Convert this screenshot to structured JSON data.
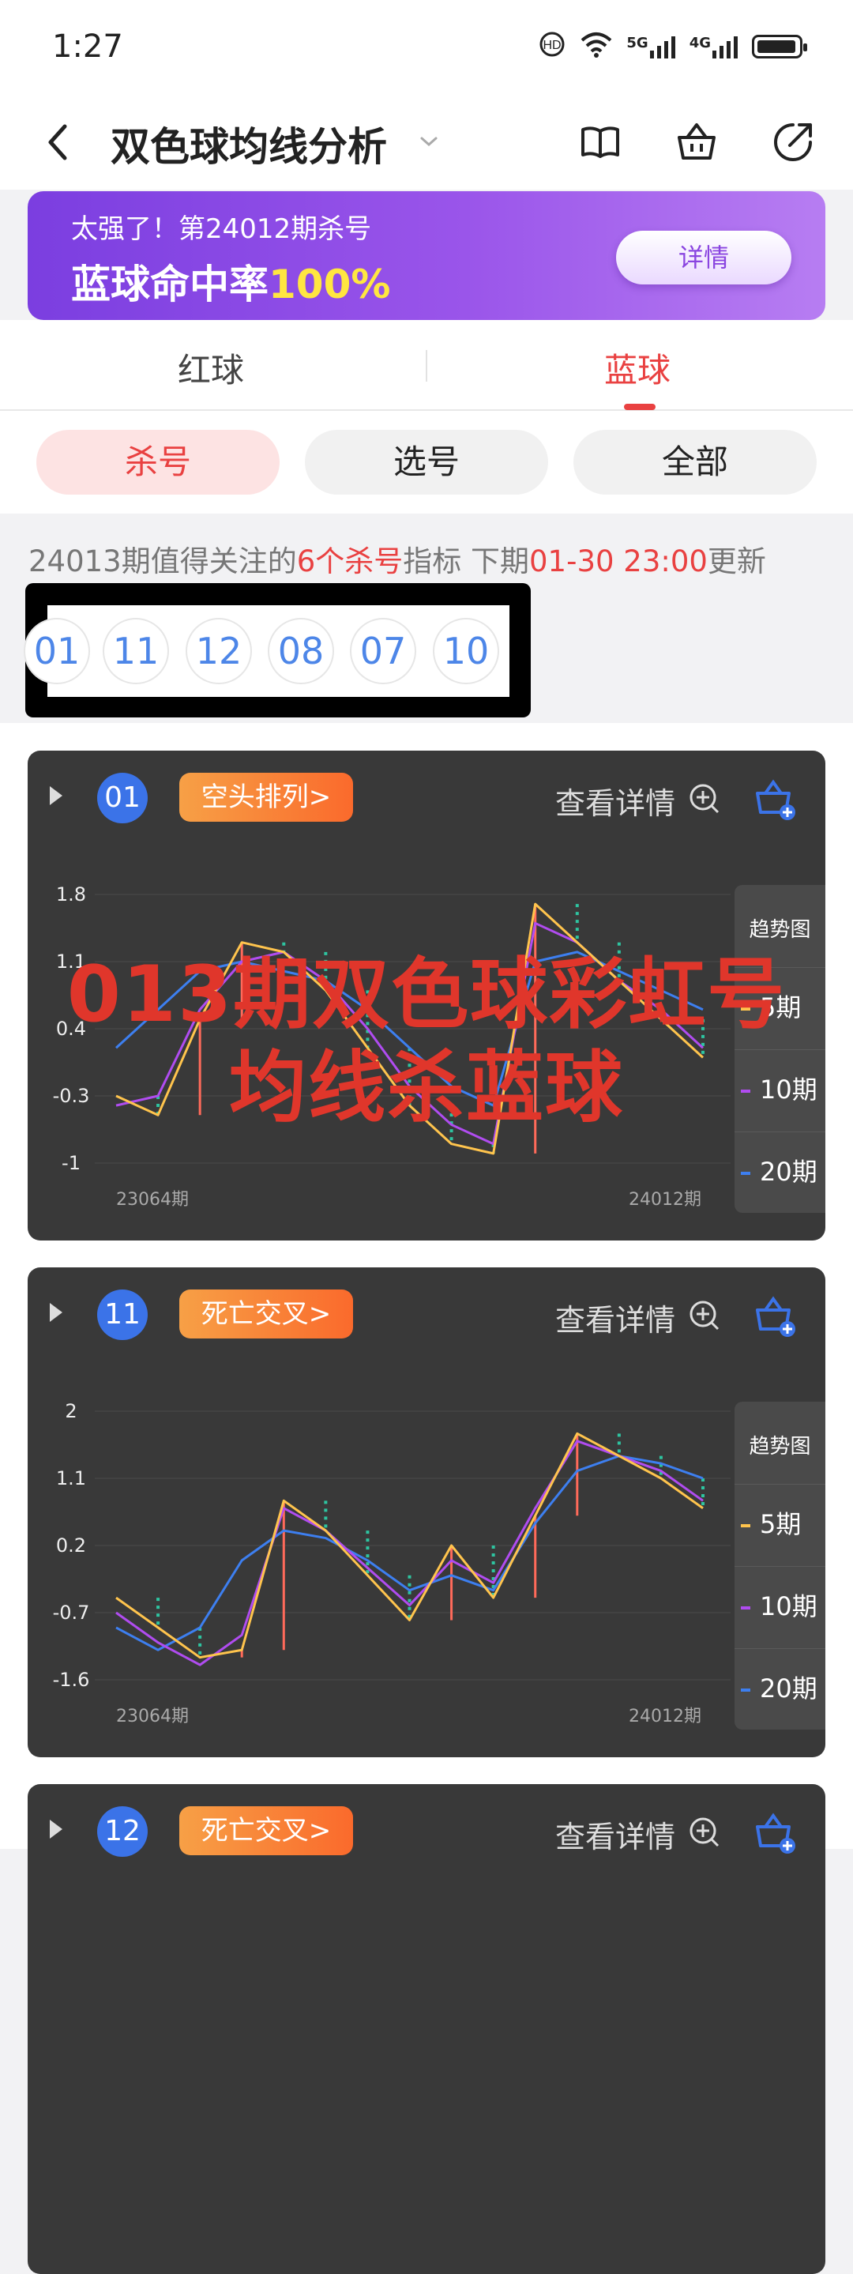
{
  "status": {
    "time": "1:27",
    "icons": [
      "hd-call-icon",
      "wifi-icon",
      "5g-signal-icon",
      "4g-signal-icon",
      "battery-icon"
    ],
    "net1": "5G",
    "net2": "4G"
  },
  "header": {
    "title": "双色球均线分析",
    "icons": [
      "back-icon",
      "chevron-down-icon",
      "book-icon",
      "basket-icon",
      "share-icon"
    ]
  },
  "banner": {
    "line1": "太强了！第24012期杀号",
    "line2_prefix": "蓝球命中率",
    "line2_highlight": "100%",
    "button": "详情"
  },
  "tabs": [
    {
      "label": "红球"
    },
    {
      "label": "蓝球"
    }
  ],
  "filters": [
    {
      "label": "杀号"
    },
    {
      "label": "选号"
    },
    {
      "label": "全部"
    }
  ],
  "info": {
    "prefix": "24013期值得关注的",
    "count": "6个杀号",
    "mid": "指标 下期",
    "time": "01-30 23:00",
    "suffix": "更新"
  },
  "kill_numbers": [
    "01",
    "11",
    "12",
    "08",
    "07",
    "10"
  ],
  "card_common": {
    "detail": "查看详情",
    "legend_title": "趋势图",
    "legend": [
      "5期",
      "10期",
      "20期"
    ],
    "x_start": "23064期",
    "x_end": "24012期"
  },
  "cards": [
    {
      "num": "01",
      "tag": "空头排列>",
      "y_ticks": [
        "1.8",
        "1.1",
        "0.4",
        "-0.3",
        "-1"
      ]
    },
    {
      "num": "11",
      "tag": "死亡交叉>",
      "y_ticks": [
        "2",
        "1.1",
        "0.2",
        "-0.7",
        "-1.6"
      ]
    },
    {
      "num": "12",
      "tag": "死亡交叉>"
    }
  ],
  "watermark": {
    "line1": "013期双色球彩虹号",
    "line2": "均线杀蓝球"
  },
  "colors": {
    "accent_red": "#e94141",
    "ball_blue": "#3b73e8",
    "ma5": "#ffc44d",
    "ma10": "#b04cf0",
    "ma20": "#3d7ff0",
    "stick_up": "#ff6a5a",
    "stick_down": "#2ec4a0"
  },
  "chart_data": [
    {
      "type": "line",
      "y_ticks": [
        1.8,
        1.1,
        0.4,
        -0.3,
        -1
      ],
      "series": [
        {
          "name": "5期",
          "values": [
            -0.3,
            -0.5,
            0.5,
            1.3,
            1.2,
            0.8,
            0.2,
            -0.4,
            -0.8,
            -0.9,
            1.7,
            1.3,
            0.9,
            0.5,
            0.1
          ]
        },
        {
          "name": "10期",
          "values": [
            -0.4,
            -0.3,
            0.6,
            1.1,
            1.2,
            0.9,
            0.4,
            -0.2,
            -0.6,
            -0.8,
            1.5,
            1.3,
            0.9,
            0.6,
            0.2
          ]
        },
        {
          "name": "20期",
          "values": [
            0.2,
            0.6,
            1.0,
            1.1,
            1.0,
            0.9,
            0.6,
            0.2,
            -0.2,
            -0.4,
            1.1,
            1.2,
            1.0,
            0.8,
            0.6
          ]
        }
      ]
    },
    {
      "type": "line",
      "y_ticks": [
        2,
        1.1,
        0.2,
        -0.7,
        -1.6
      ],
      "series": [
        {
          "name": "5期",
          "values": [
            -0.5,
            -0.9,
            -1.3,
            -1.2,
            0.8,
            0.4,
            -0.2,
            -0.8,
            0.2,
            -0.5,
            0.6,
            1.7,
            1.4,
            1.1,
            0.7
          ]
        },
        {
          "name": "10期",
          "values": [
            -0.7,
            -1.1,
            -1.4,
            -1.0,
            0.7,
            0.4,
            -0.1,
            -0.6,
            0.0,
            -0.3,
            0.7,
            1.6,
            1.4,
            1.2,
            0.8
          ]
        },
        {
          "name": "20期",
          "values": [
            -0.9,
            -1.2,
            -0.9,
            0.0,
            0.4,
            0.3,
            0.0,
            -0.4,
            -0.2,
            -0.4,
            0.5,
            1.2,
            1.4,
            1.3,
            1.1
          ]
        }
      ]
    }
  ]
}
